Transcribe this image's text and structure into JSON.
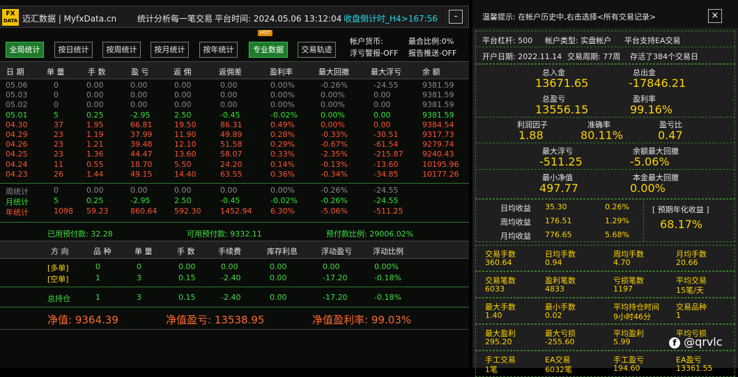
{
  "title": {
    "logo_top": "FX",
    "logo_bottom": "DATA",
    "brand": "迈汇数据 | MyfxData.cn",
    "slogan": "统计分析每一笔交易",
    "platform_time": "平台时间: 2024.05.06 13:12:04",
    "countdown": "收盘倒计时_H4>167:56",
    "minimize": "-"
  },
  "buttons": [
    "全局统计",
    "按日统计",
    "按周统计",
    "按月统计",
    "按年统计",
    "专业数据",
    "交易轨迹"
  ],
  "hot": "HOT",
  "account_info": {
    "currency": "帐户货币:",
    "ratio": "最合比例:0%",
    "float_alert": "浮亏警报-OFF",
    "report": "报告推送-OFF"
  },
  "table_headers": [
    "日 期",
    "单 量",
    "手 数",
    "盈 亏",
    "返 佣",
    "返佣差",
    "盈利率",
    "最大回撤",
    "最大浮亏",
    "余 额"
  ],
  "rows": [
    {
      "c": "gray",
      "v": [
        "05.06",
        "0",
        "0.00",
        "0.00",
        "0.00",
        "0.00",
        "0.00%",
        "-0.26%",
        "-24.55",
        "9381.59"
      ]
    },
    {
      "c": "gray",
      "v": [
        "05.03",
        "0",
        "0.00",
        "0.00",
        "0.00",
        "0.00",
        "0.00%",
        "0.00%",
        "0.00",
        "9381.59"
      ]
    },
    {
      "c": "gray",
      "v": [
        "05.02",
        "0",
        "0.00",
        "0.00",
        "0.00",
        "0.00",
        "0.00%",
        "0.00%",
        "0.00",
        "9381.59"
      ]
    },
    {
      "c": "green",
      "v": [
        "05.01",
        "5",
        "0.25",
        "-2.95",
        "2.50",
        "-0.45",
        "-0.02%",
        "0.00%",
        "0.00",
        "9381.59"
      ]
    },
    {
      "c": "red",
      "v": [
        "04.30",
        "37",
        "1.95",
        "66.81",
        "19.50",
        "86.31",
        "0.49%",
        "0.00%",
        "0.00",
        "9384.54"
      ]
    },
    {
      "c": "red",
      "v": [
        "04.29",
        "23",
        "1.19",
        "37.99",
        "11.90",
        "49.89",
        "0.28%",
        "-0.33%",
        "-30.51",
        "9317.73"
      ]
    },
    {
      "c": "red",
      "v": [
        "04.26",
        "23",
        "1.21",
        "39.48",
        "12.10",
        "51.58",
        "0.29%",
        "-0.67%",
        "-61.54",
        "9279.74"
      ]
    },
    {
      "c": "red",
      "v": [
        "04.25",
        "23",
        "1.36",
        "44.47",
        "13.60",
        "58.07",
        "0.33%",
        "-2.35%",
        "-215.87",
        "9240.43"
      ]
    },
    {
      "c": "red",
      "v": [
        "04.24",
        "11",
        "0.55",
        "18.70",
        "5.50",
        "24.20",
        "0.14%",
        "-0.13%",
        "-13.60",
        "10195.96"
      ]
    },
    {
      "c": "red",
      "v": [
        "04.23",
        "26",
        "1.44",
        "49.15",
        "14.40",
        "63.55",
        "0.36%",
        "-0.34%",
        "-34.85",
        "10177.26"
      ]
    }
  ],
  "stats_rows": [
    {
      "c": "gray",
      "v": [
        "周统计",
        "0",
        "0.00",
        "0.00",
        "0.00",
        "0.00",
        "0.00%",
        "-0.26%",
        "-24.55"
      ]
    },
    {
      "c": "green",
      "v": [
        "月统计",
        "5",
        "0.25",
        "-2.95",
        "2.50",
        "-0.45",
        "-0.02%",
        "-0.26%",
        "-24.55"
      ]
    },
    {
      "c": "red",
      "v": [
        "年统计",
        "1098",
        "59.23",
        "860.64",
        "592.30",
        "1452.94",
        "6.30%",
        "-5.06%",
        "-511.25"
      ]
    }
  ],
  "margin": {
    "used": "已用预付款: 32.28",
    "available": "可用预付款: 9332.11",
    "ratio": "预付款比例: 29006.02%"
  },
  "pos_headers": [
    "方 向",
    "品 种",
    "单 量",
    "手 数",
    "手续费",
    "库存利息",
    "浮动盈亏",
    "浮动比例"
  ],
  "pos_rows": [
    {
      "v": [
        "[多单]",
        "0",
        "0",
        "0.00",
        "0.00",
        "0.00",
        "0.00",
        "0.00%"
      ]
    },
    {
      "v": [
        "[空单]",
        "1",
        "3",
        "0.15",
        "-2.40",
        "0.00",
        "-17.20",
        "-0.18%"
      ]
    }
  ],
  "pos_total": [
    "总持仓",
    "1",
    "3",
    "0.15",
    "-2.40",
    "0.00",
    "-17.20",
    "-0.18%"
  ],
  "net": {
    "equity": "净值: 9364.39",
    "equity_pl": "净值盈亏: 13538.95",
    "equity_rate": "净值盈利率: 99.03%"
  },
  "right": {
    "tip": "温馨提示: 在帐户历史中,右击选择<所有交易记录>",
    "close": "×",
    "leverage": "平台杠杆: 500",
    "acct_type": "帐户类型: 实盘帐户",
    "ea": "平台支持EA交易",
    "open_date": "开户日期: 2022.11.14",
    "period": "交易周期: 77周",
    "orders": "存活了384个交易日",
    "deposit_l": "总入金",
    "deposit": "13671.65",
    "withdraw_l": "总出金",
    "withdraw": "-17846.21",
    "profit_l": "总盈亏",
    "profit": "13556.15",
    "rate_l": "盈利率",
    "rate": "99.16%",
    "pf_l": "利润因子",
    "pf": "1.88",
    "acc_l": "准确率",
    "acc": "80.11%",
    "plr_l": "盈亏比",
    "plr": "0.47",
    "maxfloat_l": "最大浮亏",
    "maxfloat": "-511.25",
    "maxdd_l": "余额最大回撤",
    "maxdd": "-5.06%",
    "minnet_l": "最小净值",
    "minnet": "497.77",
    "capdd_l": "本金最大回撤",
    "capdd": "0.00%",
    "daily_l": "日均收益",
    "daily": "35.30",
    "daily_p": "0.26%",
    "weekly_l": "周均收益",
    "weekly": "176.51",
    "weekly_p": "1.29%",
    "monthly_l": "月均收益",
    "monthly": "776.65",
    "monthly_p": "5.68%",
    "annual_l": "[ 预期年化收益 ]",
    "annual": "68.17%",
    "g1": [
      [
        "交易手数",
        "360.64"
      ],
      [
        "日均手数",
        "0.94"
      ],
      [
        "周均手数",
        "4.70"
      ],
      [
        "月均手数",
        "20.66"
      ]
    ],
    "g2": [
      [
        "交易笔数",
        "6033"
      ],
      [
        "盈利笔数",
        "4833"
      ],
      [
        "亏损笔数",
        "1197"
      ],
      [
        "平均交易",
        "15笔/天"
      ]
    ],
    "g3": [
      [
        "最大手数",
        "1.40"
      ],
      [
        "最小手数",
        "0.02"
      ],
      [
        "平均持仓时间",
        "9小时46分"
      ],
      [
        "交易品种",
        "1"
      ]
    ],
    "g4": [
      [
        "最大盈利",
        "295.20"
      ],
      [
        "最大亏损",
        "-255.60"
      ],
      [
        "平均盈利",
        "5.99"
      ],
      [
        "平均亏损",
        ""
      ]
    ],
    "g5": [
      [
        "手工交易",
        "1笔"
      ],
      [
        "EA交易",
        "6032笔"
      ],
      [
        "手工盈亏",
        "194.60"
      ],
      [
        "EA盈亏",
        "13361.55"
      ]
    ],
    "watermark": "@qrvlc"
  }
}
